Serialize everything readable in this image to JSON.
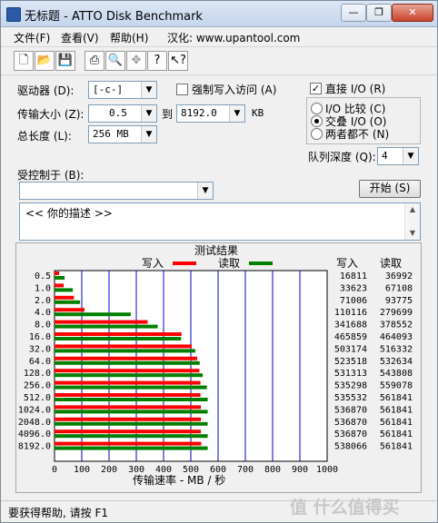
{
  "window": {
    "title": "无标题 - ATTO Disk Benchmark",
    "controls": {
      "minimize": "—",
      "restore": "❐",
      "close": "✕"
    }
  },
  "menu": [
    "文件(F)",
    "查看(V)",
    "帮助(H)",
    "汉化: www.upantool.com"
  ],
  "toolbar_icons": [
    "new-file-icon",
    "open-folder-icon",
    "save-icon",
    "print-icon",
    "print-preview-icon",
    "move-icon",
    "help-icon",
    "context-help-icon"
  ],
  "settings": {
    "drive_label": "驱动器 (D):",
    "drive_value": "[-c-]",
    "transfer_size_label": "传输大小 (Z):",
    "transfer_min": "0.5",
    "to_label": "到",
    "transfer_max": "8192.0",
    "kb_unit": "KB",
    "total_length_label": "总长度 (L):",
    "total_length_value": "256 MB",
    "force_write_label": "强制写入访问 (A)",
    "direct_io_label": "直接 I/O (R)",
    "io_compare_label": "I/O 比较 (C)",
    "io_overlap_label": "交叠 I/O (O)",
    "neither_label": "两者都不 (N)",
    "queue_depth_label": "队列深度 (Q):",
    "queue_depth_value": "4",
    "controlled_by_label": "受控制于 (B):",
    "controlled_by_value": "",
    "start_button": "开始 (S)",
    "description": "<<   你的描述   >>"
  },
  "results": {
    "title": "测试结果",
    "legend_write": "写入",
    "legend_read": "读取",
    "col_write": "写入",
    "col_read": "读取",
    "xlabel": "传输速率 - MB / 秒"
  },
  "chart_data": {
    "type": "bar",
    "orientation": "horizontal",
    "title": "测试结果",
    "xlabel": "传输速率 - MB / 秒",
    "xlim": [
      0,
      1000
    ],
    "xticks": [
      "0",
      "100",
      "200",
      "300",
      "400",
      "500",
      "600",
      "700",
      "800",
      "900",
      "1000"
    ],
    "categories": [
      "0.5",
      "1.0",
      "2.0",
      "4.0",
      "8.0",
      "16.0",
      "32.0",
      "64.0",
      "128.0",
      "256.0",
      "512.0",
      "1024.0",
      "2048.0",
      "4096.0",
      "8192.0"
    ],
    "series": [
      {
        "name": "写入",
        "color": "#ff0000",
        "values": [
          16811,
          33623,
          71006,
          110116,
          341688,
          465859,
          503174,
          523518,
          531313,
          535298,
          535532,
          536870,
          536870,
          536870,
          538066
        ]
      },
      {
        "name": "读取",
        "color": "#008000",
        "values": [
          36992,
          67108,
          93775,
          279699,
          378552,
          464093,
          516332,
          532634,
          543808,
          559078,
          561841,
          561841,
          561841,
          561841,
          561841
        ]
      }
    ],
    "value_unit_divisor": 1000,
    "gridline_color": "#0000cc"
  },
  "status": {
    "text": "要获得帮助, 请按 F1",
    "watermark": "值 什么值得买"
  }
}
